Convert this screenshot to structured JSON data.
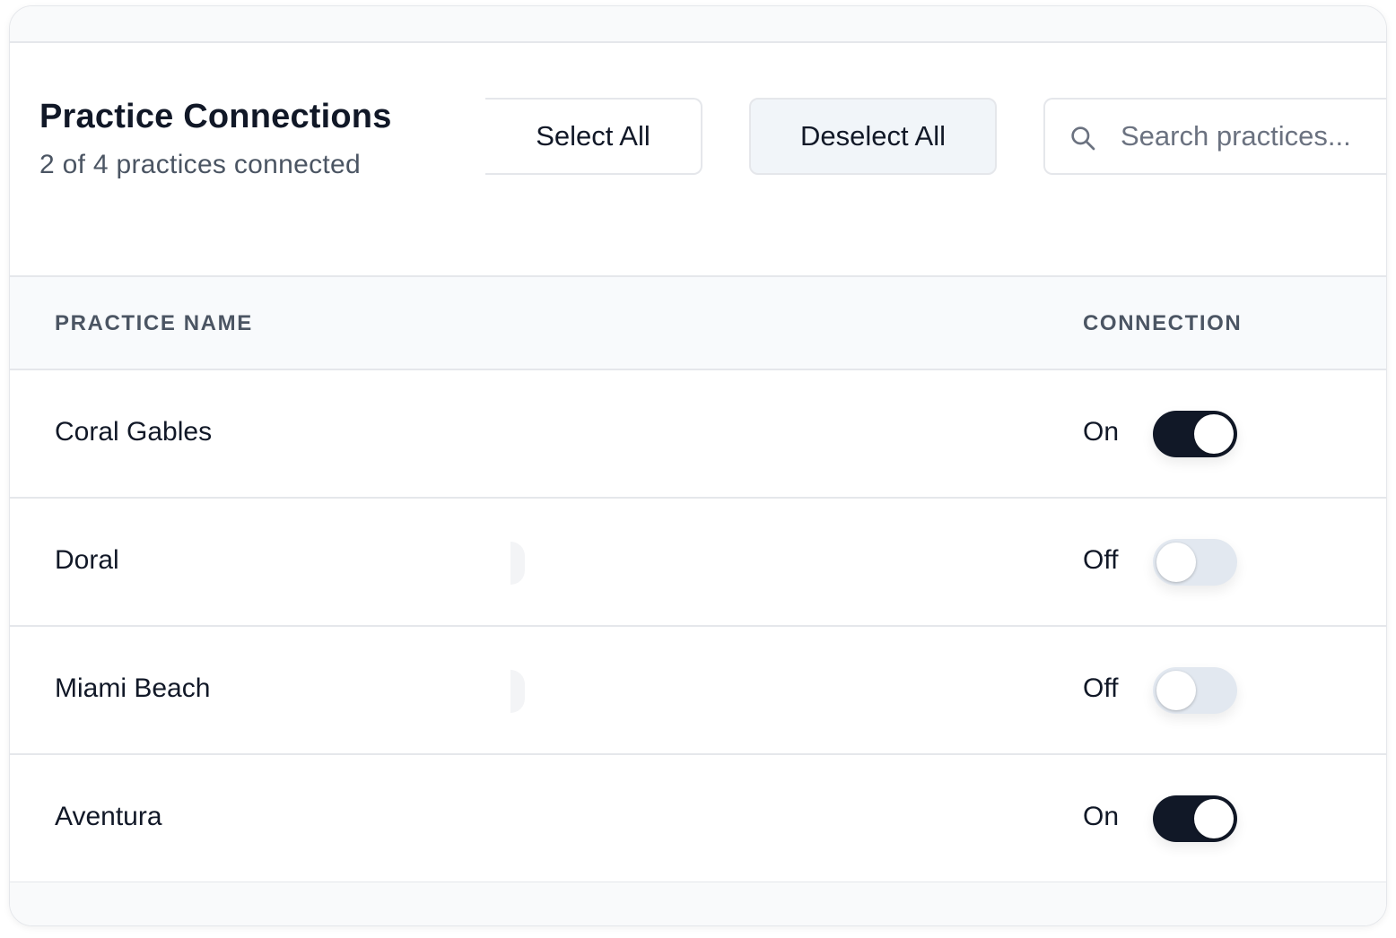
{
  "header": {
    "title": "Practice Connections",
    "subtitle": "2 of 4 practices connected"
  },
  "actions": {
    "select_all_label": "Select All",
    "deselect_all_label": "Deselect All"
  },
  "search": {
    "placeholder": "Search practices...",
    "value": ""
  },
  "table": {
    "columns": [
      "PRACTICE NAME",
      "CONNECTION"
    ],
    "rows": [
      {
        "name": "Coral Gables",
        "state": "On",
        "connected": true
      },
      {
        "name": "Doral",
        "state": "Off",
        "connected": false
      },
      {
        "name": "Miami Beach",
        "state": "Off",
        "connected": false
      },
      {
        "name": "Aventura",
        "state": "On",
        "connected": true
      }
    ]
  },
  "colors": {
    "toggle_on": "#111827",
    "toggle_off": "#e2e8f0",
    "header_bg": "#f8fafc",
    "border": "#e5e7eb"
  }
}
